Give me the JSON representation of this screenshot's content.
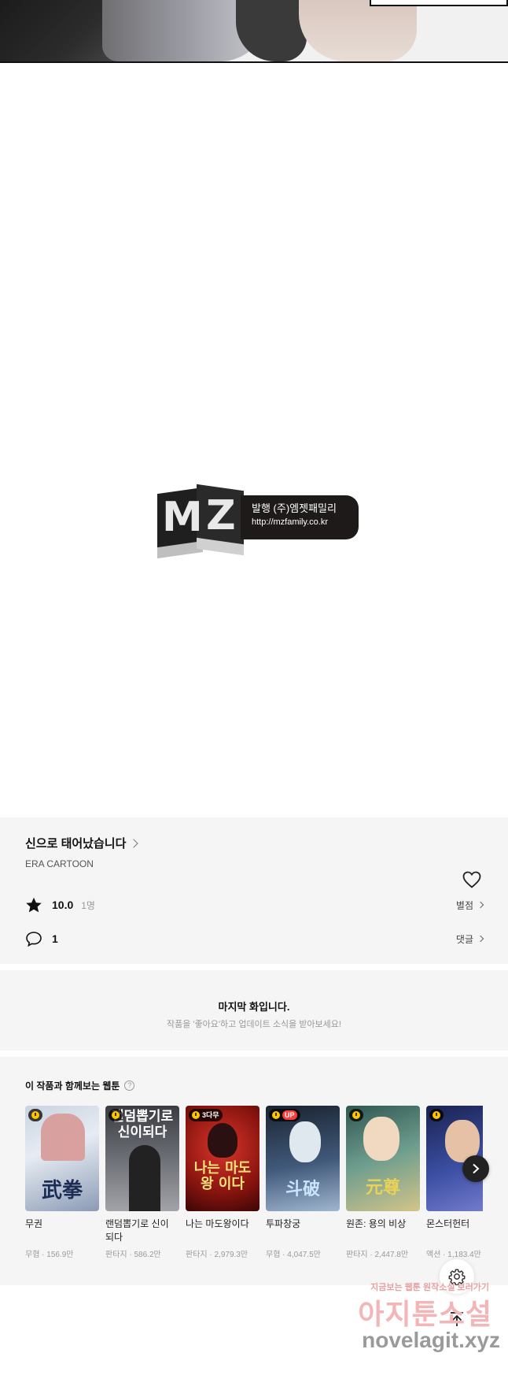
{
  "comic": {
    "description_hidden": ""
  },
  "publisher": {
    "line1": "발행 (주)엠젯패밀리",
    "line2": "http://mzfamily.co.kr",
    "logo_letters": [
      "M",
      "Z"
    ]
  },
  "work": {
    "title": "신으로 태어났습니다",
    "author": "ERA CARTOON",
    "rating": "10.0",
    "rating_count": "1명",
    "rating_link": "별점",
    "comments": "1",
    "comment_link": "댓글"
  },
  "last_episode": {
    "heading": "마지막 화입니다.",
    "sub": "작품을 '좋아요'하고 업데이트 소식을 받아보세요!"
  },
  "recommendations": {
    "heading": "이 작품과 함께보는 웹툰",
    "help_symbol": "?",
    "items": [
      {
        "name": "무권",
        "meta": "무협 · 156.9만",
        "badge": "",
        "cover": "",
        "accent": "#8fa7c7"
      },
      {
        "name": "랜덤뽑기로 신이 되다",
        "meta": "판타지 · 586.2만",
        "badge": "",
        "cover": "랜덤뽑기로 신이되다",
        "accent": "#4a4e57"
      },
      {
        "name": "나는 마도왕이다",
        "meta": "판타지 · 2,979.3만",
        "badge": "3다무",
        "cover": "나는 마도왕 이다",
        "accent": "#9a1f1a"
      },
      {
        "name": "투파창궁",
        "meta": "무협 · 4,047.5만",
        "badge": "UP",
        "cover": "",
        "accent": "#2b3b52"
      },
      {
        "name": "원존: 용의 비상",
        "meta": "판타지 · 2,447.8만",
        "badge": "",
        "cover": "",
        "accent": "#3f6a66"
      },
      {
        "name": "몬스터헌터",
        "meta": "액션 · 1,183.4만",
        "badge": "",
        "cover": "",
        "accent": "#2e3f7a"
      }
    ]
  },
  "watermark": {
    "line1": "지금보는 웹툰 원작소설 보러가기",
    "line2": "아지툰소설",
    "line3": "novelagit.xyz"
  },
  "colors": {
    "section_bg": "#f5f5f5",
    "badge_yellow": "#ffc400",
    "badge_up_red": "#ff3a3a"
  }
}
